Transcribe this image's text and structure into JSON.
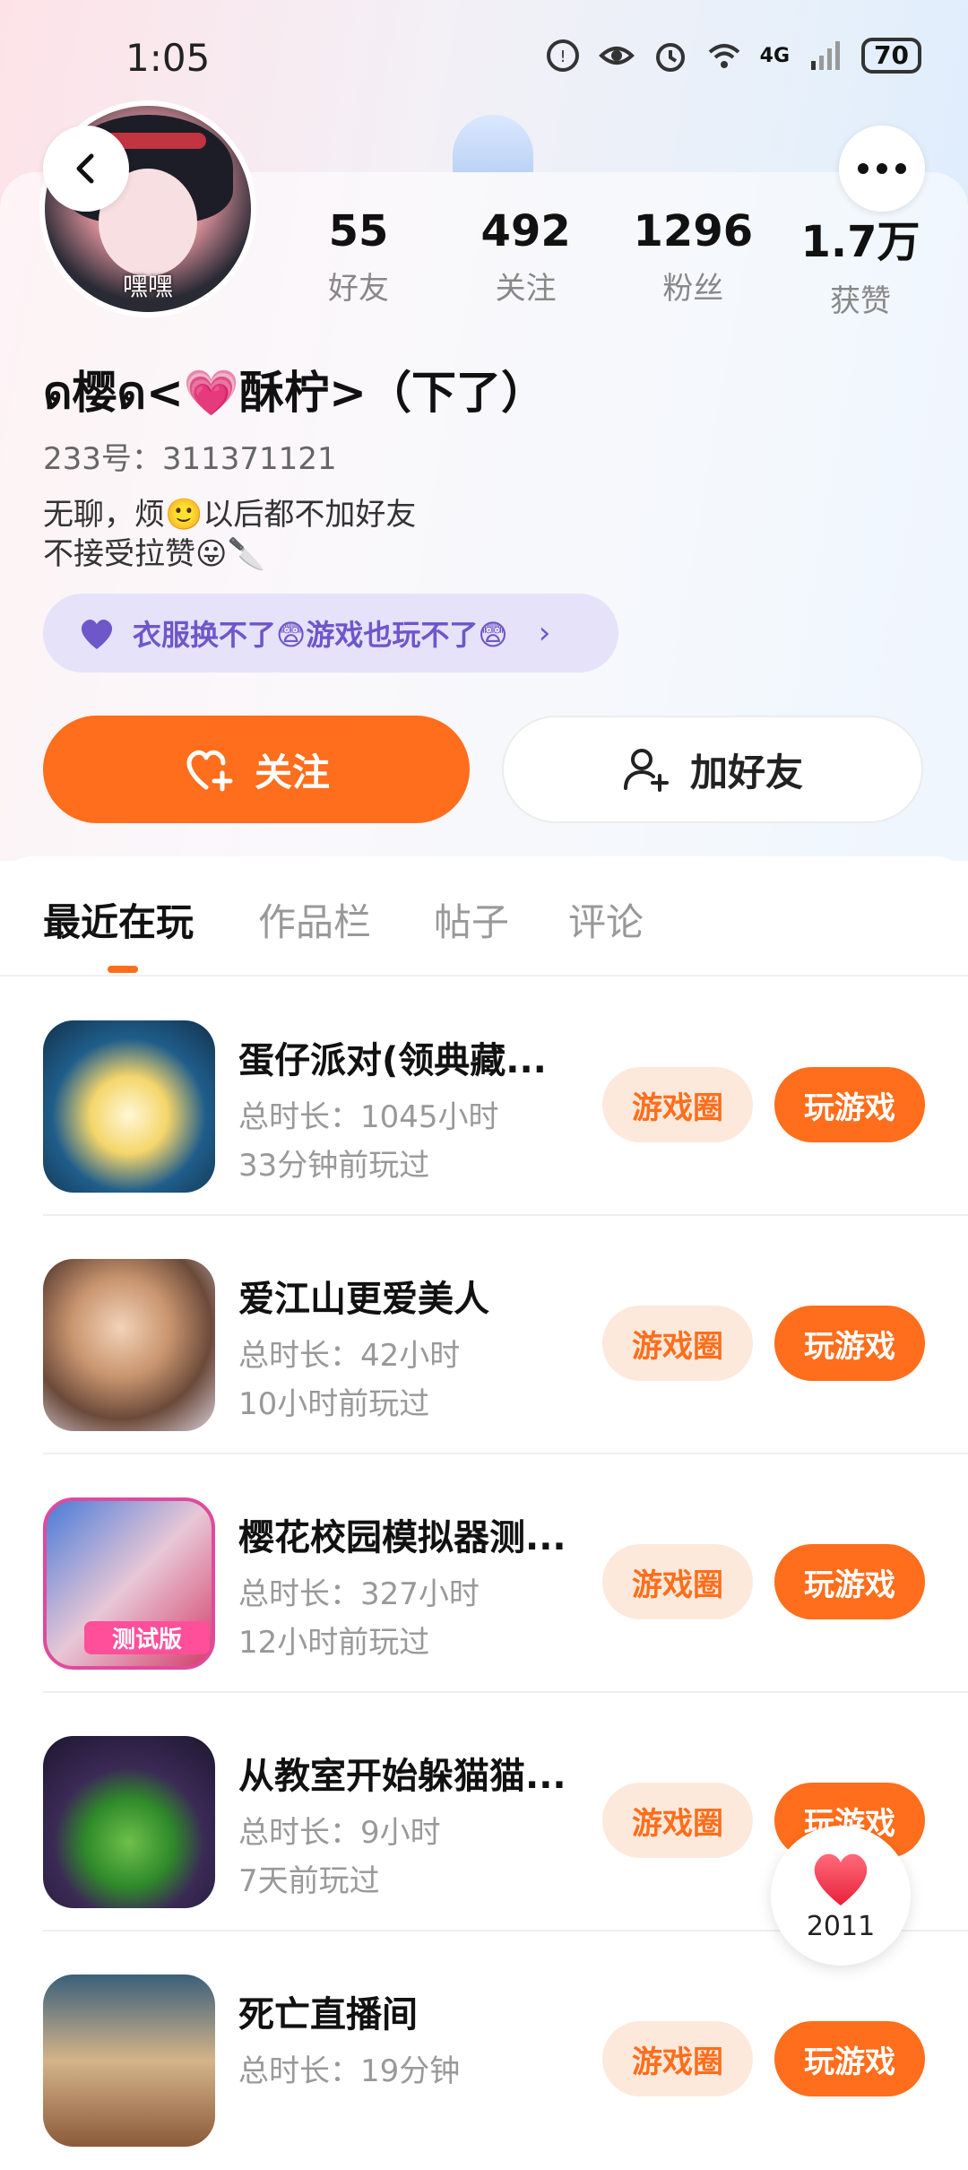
{
  "status_bar": {
    "time": "1:05",
    "battery": "70",
    "network": "4G"
  },
  "profile": {
    "avatar_caption": "嘿嘿",
    "nickname": "ด樱ด<💗酥柠>（下了）",
    "uid": "233号：311371121",
    "bio_lines": [
      "无聊，烦🙂以后都不加好友",
      "不接受拉赞😛🔪"
    ],
    "tag": {
      "text": "衣服换不了😨游戏也玩不了😨"
    }
  },
  "stats": [
    {
      "value": "55",
      "label": "好友"
    },
    {
      "value": "492",
      "label": "关注"
    },
    {
      "value": "1296",
      "label": "粉丝"
    },
    {
      "value": "1.7万",
      "label": "获赞"
    }
  ],
  "actions": {
    "follow_label": "关注",
    "add_friend_label": "加好友"
  },
  "tabs": [
    {
      "label": "最近在玩",
      "active": true
    },
    {
      "label": "作品栏",
      "active": false
    },
    {
      "label": "帖子",
      "active": false
    },
    {
      "label": "评论",
      "active": false
    }
  ],
  "games": [
    {
      "title": "蛋仔派对(领典藏...",
      "total": "总时长：1045小时",
      "last_played": "33分钟前玩过",
      "circle_label": "游戏圈",
      "play_label": "玩游戏"
    },
    {
      "title": "爱江山更爱美人",
      "total": "总时长：42小时",
      "last_played": "10小时前玩过",
      "circle_label": "游戏圈",
      "play_label": "玩游戏"
    },
    {
      "title": "樱花校园模拟器测...",
      "total": "总时长：327小时",
      "last_played": "12小时前玩过",
      "circle_label": "游戏圈",
      "play_label": "玩游戏"
    },
    {
      "title": "从教室开始躲猫猫...",
      "total": "总时长：9小时",
      "last_played": "7天前玩过",
      "circle_label": "游戏圈",
      "play_label": "玩游戏"
    },
    {
      "title": "死亡直播间",
      "total": "总时长：19分钟",
      "last_played": "",
      "circle_label": "游戏圈",
      "play_label": "玩游戏"
    }
  ],
  "game_icon_labels": {
    "game3_badge": "测试版"
  },
  "like_fab": {
    "count": "2011"
  },
  "colors": {
    "accent": "#ff6e1c",
    "accent_soft": "#fde9dc",
    "tag_bg": "#e6e2fa",
    "tag_text": "#6d57c9"
  }
}
